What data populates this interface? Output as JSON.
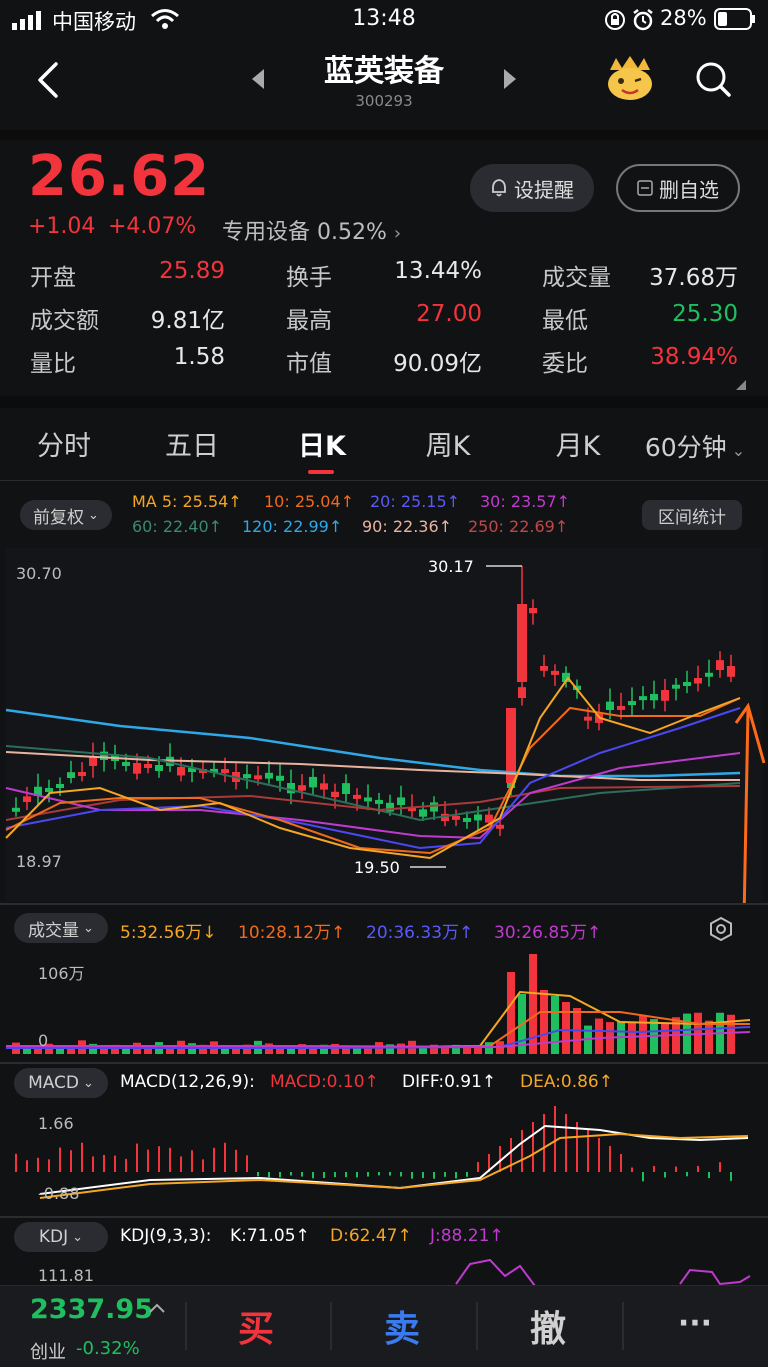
{
  "status_bar": {
    "carrier": "中国移动",
    "time": "13:48",
    "battery": "28%"
  },
  "header": {
    "title": "蓝英装备",
    "code": "300293",
    "back_icon": "chevron-left",
    "search_icon": "search"
  },
  "quote": {
    "price": "26.62",
    "change": "+1.04",
    "change_pct": "+4.07%",
    "sector": "专用设备 0.52%",
    "alert_label": "设提醒",
    "remove_label": "删自选"
  },
  "stats": [
    {
      "label": "开盘",
      "value": "25.89",
      "color": "red"
    },
    {
      "label": "换手",
      "value": "13.44%",
      "color": "white"
    },
    {
      "label": "成交量",
      "value": "37.68万",
      "color": "white"
    },
    {
      "label": "成交额",
      "value": "9.81亿",
      "color": "white"
    },
    {
      "label": "最高",
      "value": "27.00",
      "color": "red"
    },
    {
      "label": "最低",
      "value": "25.30",
      "color": "green"
    },
    {
      "label": "量比",
      "value": "1.58",
      "color": "white"
    },
    {
      "label": "市值",
      "value": "90.09亿",
      "color": "white"
    },
    {
      "label": "委比",
      "value": "38.94%",
      "color": "red"
    }
  ],
  "tabs": [
    "分时",
    "五日",
    "日K",
    "周K",
    "月K",
    "60分钟"
  ],
  "active_tab": "日K",
  "kline": {
    "adjust_label": "前复权",
    "interval_label": "区间统计",
    "ma_line1": {
      "ma5": "MA 5: 25.54↑",
      "ma10": "10: 25.04↑",
      "ma20": "20: 25.15↑",
      "ma30": "30: 23.57↑"
    },
    "ma_line2": {
      "ma60": "60: 22.40↑",
      "ma120": "120: 22.99↑",
      "ma90": "90: 22.36↑",
      "ma250": "250: 22.69↑"
    },
    "top_axis": "30.70",
    "bottom_axis": "18.97",
    "high_mark": "30.17",
    "low_mark": "19.50"
  },
  "volume": {
    "label": "成交量",
    "v5": "5:32.56万↓",
    "v10": "10:28.12万↑",
    "v20": "20:36.33万↑",
    "v30": "30:26.85万↑",
    "axis_top": "106万",
    "axis_zero": "0"
  },
  "macd": {
    "label": "MACD",
    "params": "MACD(12,26,9):",
    "macd": "MACD:0.10↑",
    "diff": "DIFF:0.91↑",
    "dea": "DEA:0.86↑",
    "axis_top": "1.66",
    "axis_bottom": "-0.88"
  },
  "kdj": {
    "label": "KDJ",
    "params": "KDJ(9,3,3):",
    "k": "K:71.05↑",
    "d": "D:62.47↑",
    "j": "J:88.21↑",
    "axis_top": "111.81"
  },
  "footer": {
    "index_value": "2337.95",
    "index_name": "创业",
    "index_change": "-0.32%",
    "buy": "买",
    "sell": "卖",
    "cancel": "撤",
    "more": "···"
  },
  "colors": {
    "up": "#f2343c",
    "down": "#1fbf5f",
    "ma5": "#f5a623",
    "ma10": "#f06a1c",
    "ma20": "#4a49f0",
    "ma30": "#c03ad0",
    "ma60": "#2c6e5a",
    "ma120": "#2fa8e8",
    "ma90": "#e8b4a0",
    "ma250": "#a83a3a",
    "arrow": "#ff6a1a"
  }
}
